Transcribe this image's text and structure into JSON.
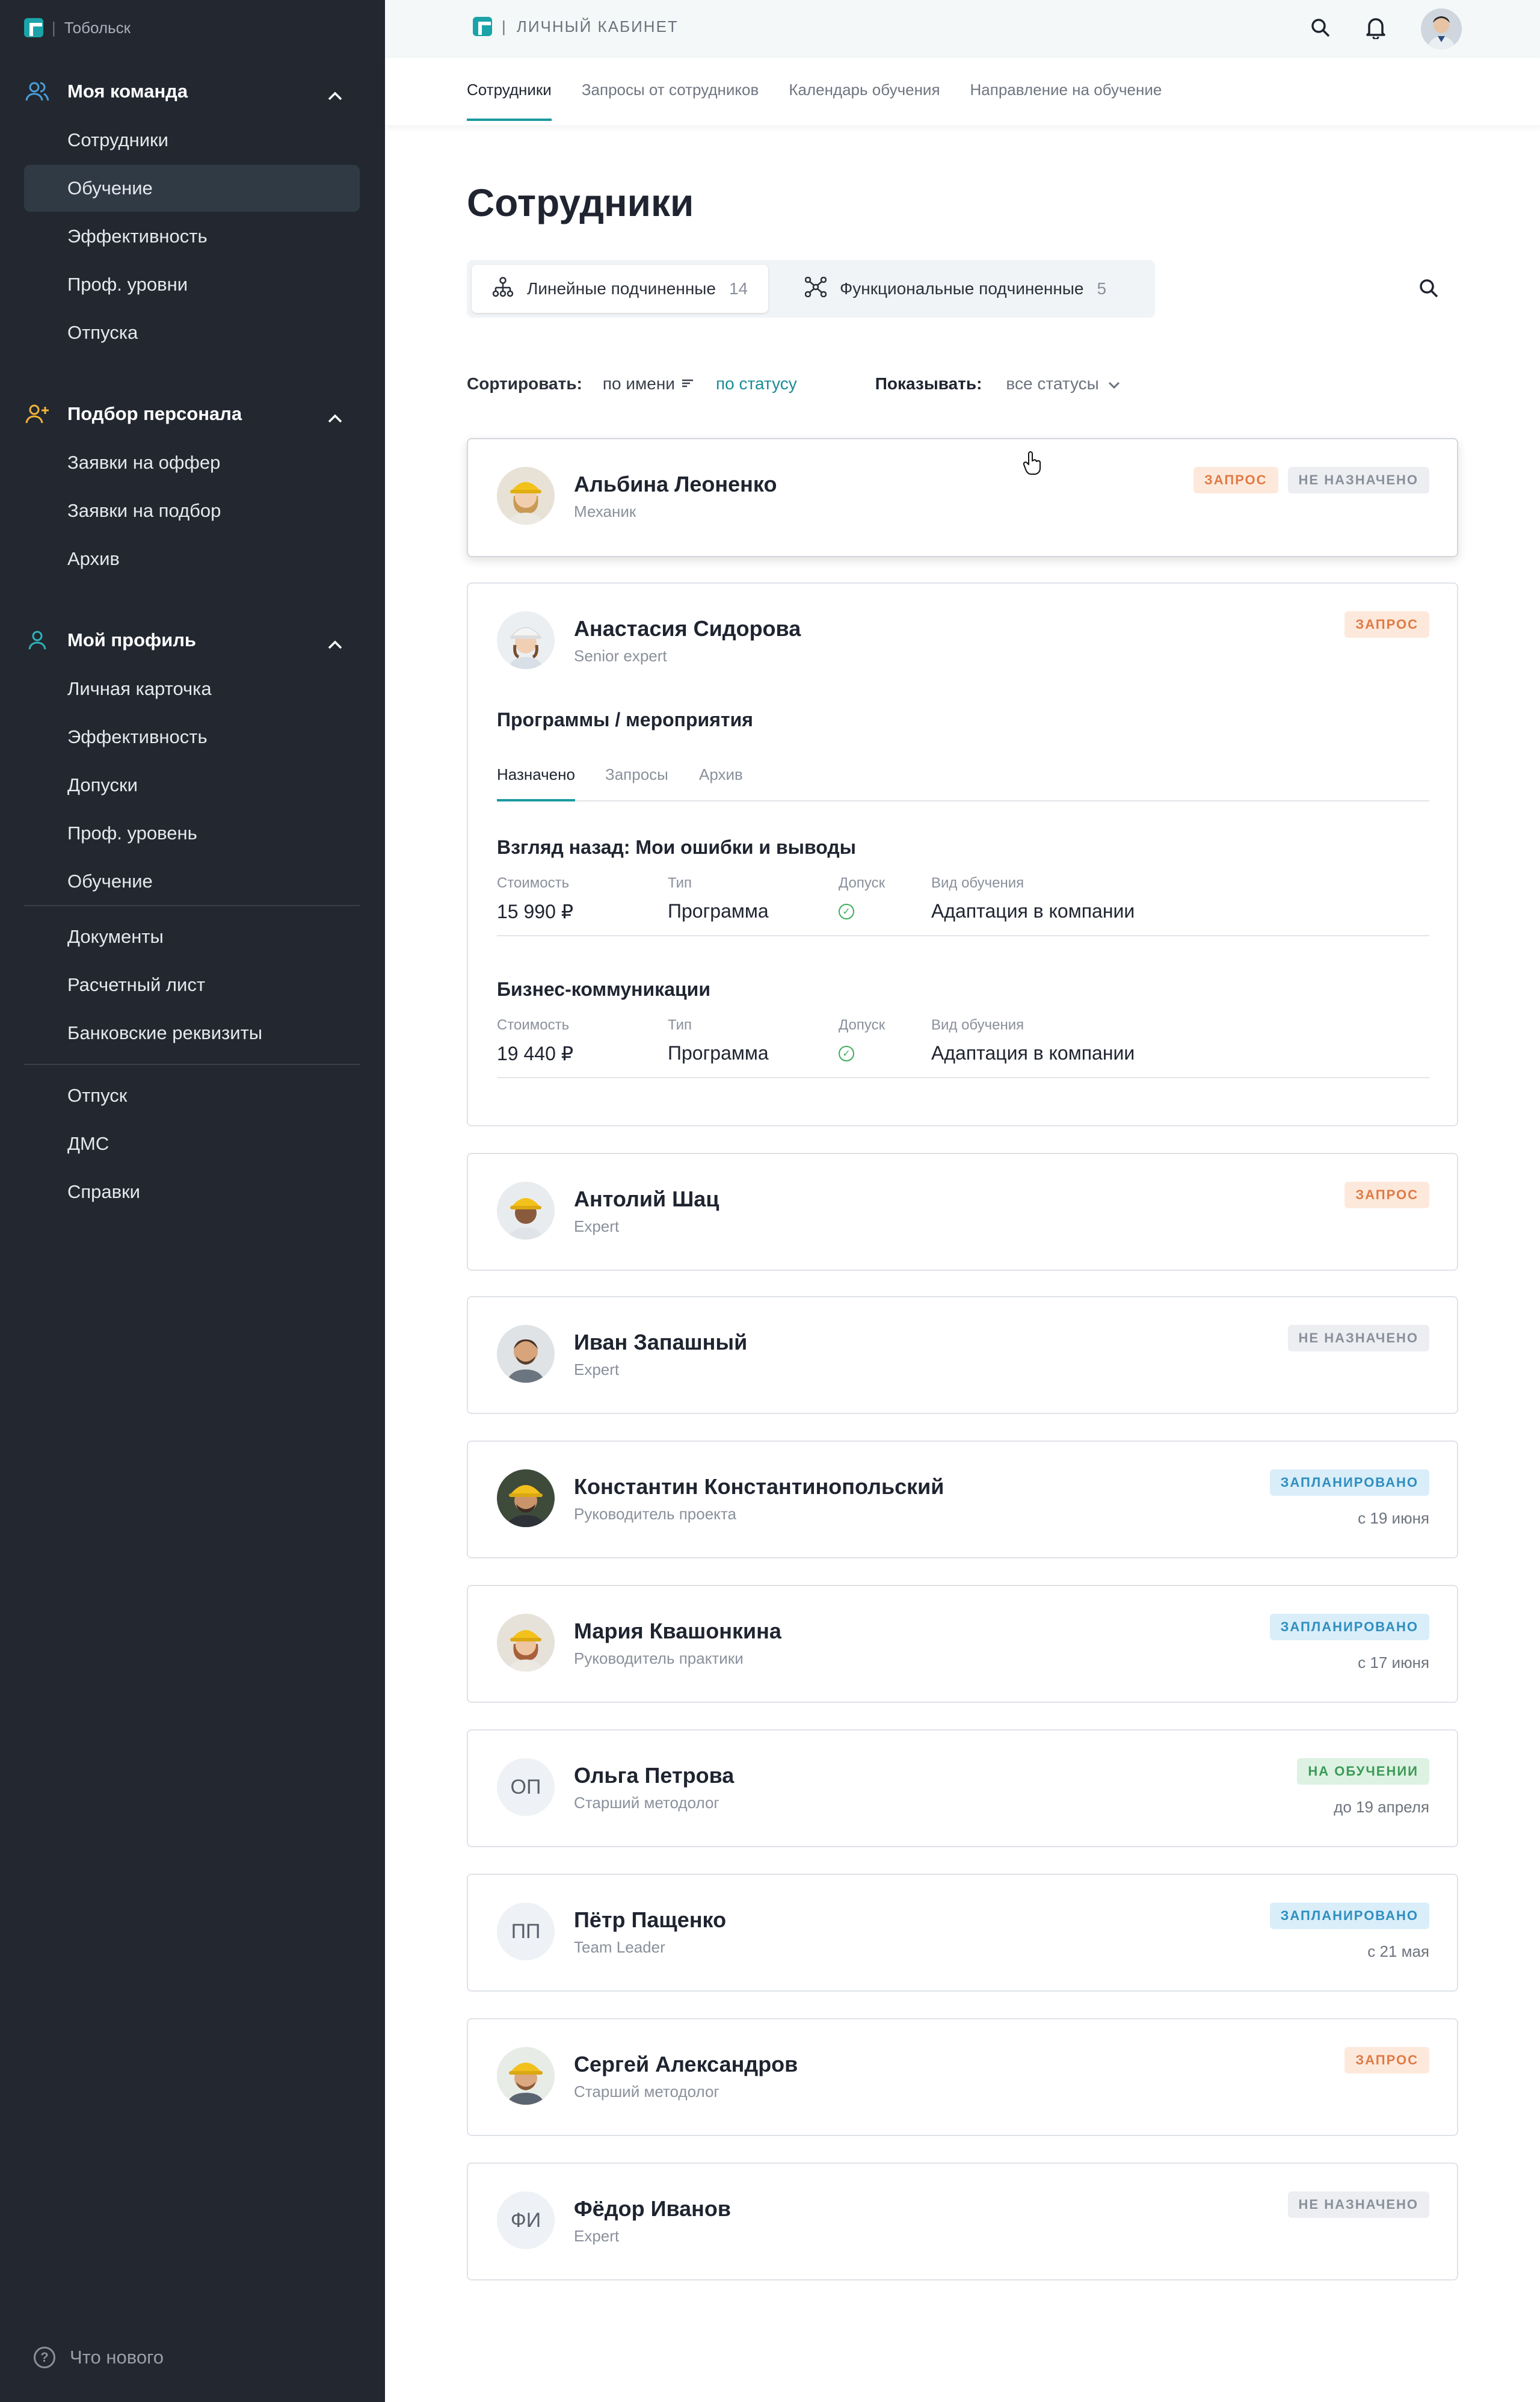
{
  "sidebar": {
    "city": "Тобольск",
    "groups": [
      {
        "title": "Моя команда",
        "items": [
          "Сотрудники",
          "Обучение",
          "Эффективность",
          "Проф. уровни",
          "Отпуска"
        ]
      },
      {
        "title": "Подбор персонала",
        "items": [
          "Заявки на оффер",
          "Заявки на подбор",
          "Архив"
        ]
      },
      {
        "title": "Мой профиль",
        "items": [
          "Личная карточка",
          "Эффективность",
          "Допуски",
          "Проф. уровень",
          "Обучение"
        ]
      }
    ],
    "extra1": [
      "Документы",
      "Расчетный лист",
      "Банковские реквизиты"
    ],
    "extra2": [
      "Отпуск",
      "ДМС",
      "Справки"
    ],
    "whats_new": "Что нового",
    "whats_new_icon": "?"
  },
  "topbar": {
    "title": "ЛИЧНЫЙ КАБИНЕТ",
    "sep": "|"
  },
  "subnav": [
    "Сотрудники",
    "Запросы от сотрудников",
    "Календарь обучения",
    "Направление на обучение"
  ],
  "page": {
    "title": "Сотрудники",
    "segments": [
      {
        "label": "Линейные подчиненные",
        "count": "14"
      },
      {
        "label": "Функциональные подчиненные",
        "count": "5"
      }
    ],
    "sort_label": "Сортировать:",
    "sort_by_name": "по имени",
    "sort_by_status": "по статусу",
    "show_label": "Показывать:",
    "show_value": "все статусы"
  },
  "employees": [
    {
      "name": "Альбина Леоненко",
      "role": "Механик",
      "badges": [
        "ЗАПРОС",
        "НЕ НАЗНАЧЕНО"
      ]
    },
    {
      "name": "Анастасия Сидорова",
      "role": "Senior expert",
      "badges": [
        "ЗАПРОС"
      ]
    },
    {
      "name": "Антолий Шац",
      "role": "Expert",
      "badges": [
        "ЗАПРОС"
      ]
    },
    {
      "name": "Иван Запашный",
      "role": "Expert",
      "badges": [
        "НЕ НАЗНАЧЕНО"
      ]
    },
    {
      "name": "Константин Константинопольский",
      "role": "Руководитель проекта",
      "badges": [
        "ЗАПЛАНИРОВАНО"
      ],
      "date": "с 19 июня"
    },
    {
      "name": "Мария Квашонкина",
      "role": "Руководитель практики",
      "badges": [
        "ЗАПЛАНИРОВАНО"
      ],
      "date": "с 17 июня"
    },
    {
      "name": "Ольга Петрова",
      "role": "Старший методолог",
      "initials": "ОП",
      "badges": [
        "НА ОБУЧЕНИИ"
      ],
      "date": "до 19 апреля"
    },
    {
      "name": "Пётр Пащенко",
      "role": "Team Leader",
      "initials": "ПП",
      "badges": [
        "ЗАПЛАНИРОВАНО"
      ],
      "date": "с 21 мая"
    },
    {
      "name": "Сергей Александров",
      "role": "Старший методолог",
      "badges": [
        "ЗАПРОС"
      ]
    },
    {
      "name": "Фёдор Иванов",
      "role": "Expert",
      "initials": "ФИ",
      "badges": [
        "НЕ НАЗНАЧЕНО"
      ]
    }
  ],
  "expanded": {
    "programs_title": "Программы / мероприятия",
    "tabs": [
      "Назначено",
      "Запросы",
      "Архив"
    ],
    "labels": {
      "cost": "Стоимость",
      "type": "Тип",
      "access": "Допуск",
      "kind": "Вид обучения"
    },
    "programs": [
      {
        "title": "Взгляд назад: Мои ошибки и выводы",
        "cost": "15 990 ₽",
        "type": "Программа",
        "kind": "Адаптация в компании"
      },
      {
        "title": "Бизнес-коммуникации",
        "cost": "19 440 ₽",
        "type": "Программа",
        "kind": "Адаптация в компании"
      }
    ]
  },
  "colors": {
    "accent": "#1a9aa0",
    "sidebar": "#222730",
    "request": "#e07a45",
    "planned": "#2f8ec0",
    "training": "#3c9a57"
  }
}
